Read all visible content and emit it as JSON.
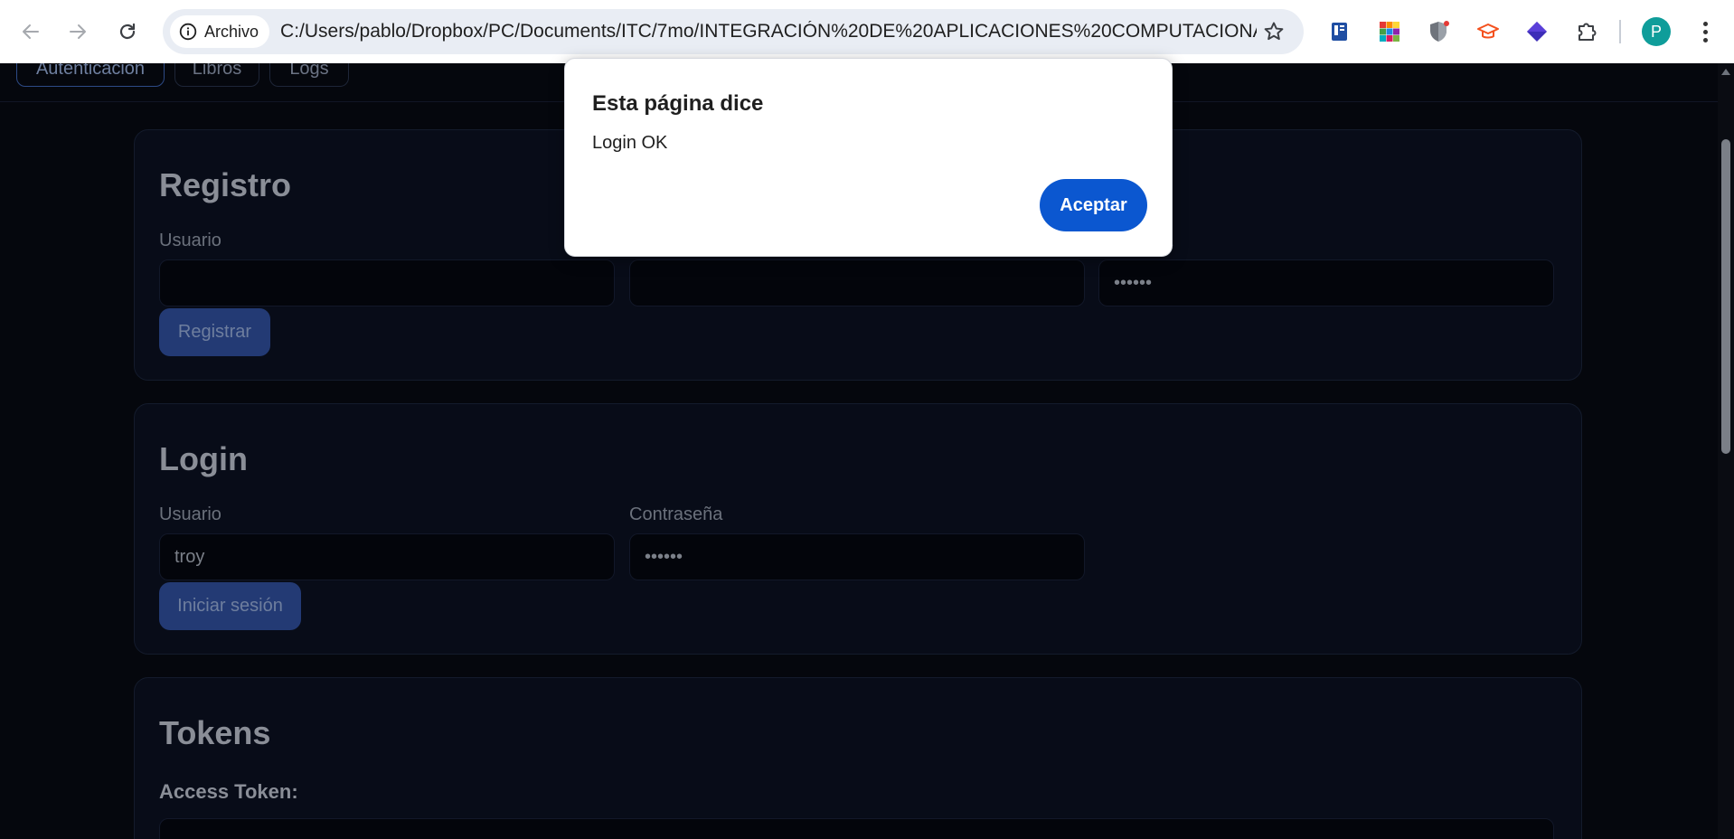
{
  "browser": {
    "site_chip_label": "Archivo",
    "url": "C:/Users/pablo/Dropbox/PC/Documents/ITC/7mo/INTEGRACIÓN%20DE%20APLICACIONES%20COMPUTACIONA...",
    "profile_initial": "P"
  },
  "page_tabs": [
    "Autenticación",
    "Libros",
    "Logs"
  ],
  "registro": {
    "title": "Registro",
    "user_label": "Usuario",
    "password_label_partial": "ña",
    "password_value": "••••••",
    "submit_label": "Registrar"
  },
  "login": {
    "title": "Login",
    "user_label": "Usuario",
    "user_value": "troy",
    "password_label": "Contraseña",
    "password_value": "••••••",
    "submit_label": "Iniciar sesión"
  },
  "tokens": {
    "title": "Tokens",
    "access_token_label": "Access Token:"
  },
  "dialog": {
    "title": "Esta página dice",
    "message": "Login OK",
    "ok_label": "Aceptar"
  },
  "colors": {
    "dialog_button": "#0b57d0",
    "page_background": "#05070d",
    "primary_button": "#233a74"
  }
}
